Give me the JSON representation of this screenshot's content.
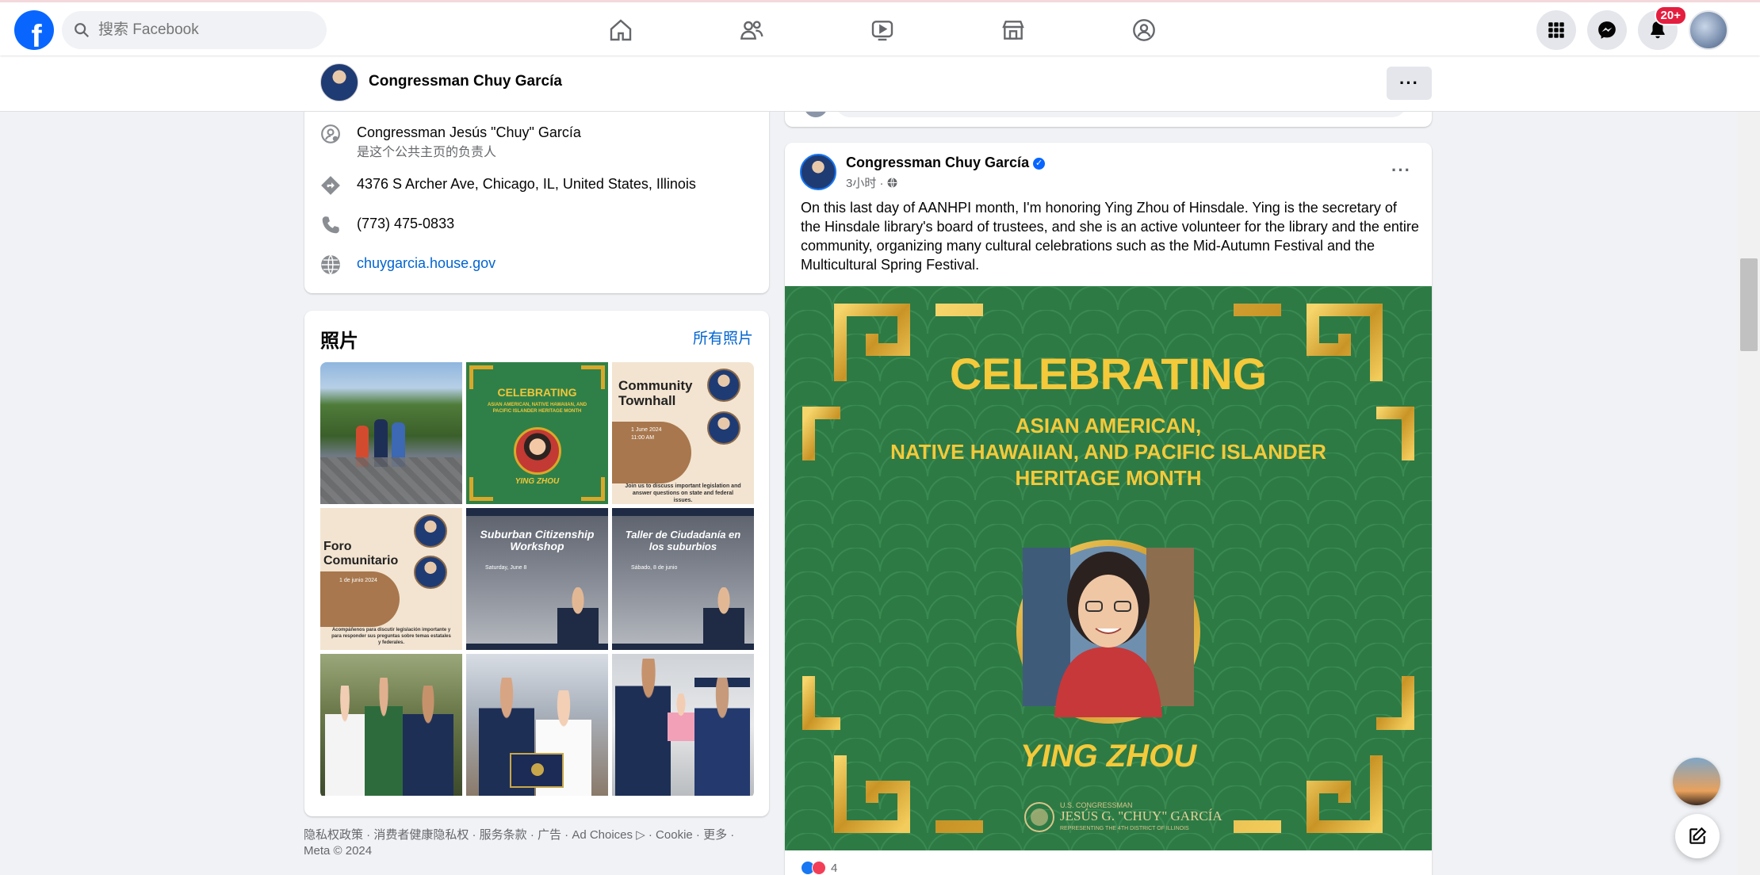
{
  "nav": {
    "logo": "f",
    "search_placeholder": "搜索 Facebook",
    "notifications_badge": "20+"
  },
  "page_header": {
    "name": "Congressman Chuy García",
    "more": "···"
  },
  "intro": {
    "owner_name": "Congressman Jesús \"Chuy\" García",
    "owner_role": "是这个公共主页的负责人",
    "address": "4376 S Archer Ave, Chicago, IL, United States, Illinois",
    "phone": "(773) 475-0833",
    "website": "chuygarcia.house.gov"
  },
  "photos": {
    "title": "照片",
    "see_all": "所有照片",
    "tiles": {
      "t2_title": "CELEBRATING",
      "t2_sub": "ASIAN AMERICAN, NATIVE HAWAIIAN, AND PACIFIC ISLANDER HERITAGE MONTH",
      "t2_name": "YING ZHOU",
      "t3_title": "Community Townhall",
      "t3_date": "1 June 2024",
      "t3_time": "11:00 AM",
      "t3_body": "Join us to discuss important legislation and answer questions on state and federal issues.",
      "t4_title": "Foro Comunitario",
      "t4_date": "1 de junio 2024",
      "t4_body": "Acompáñenos para discutir legislación importante y para responder sus preguntas sobre temas estatales y federales.",
      "t5_title": "Suburban Citizenship Workshop",
      "t5_date": "Saturday, June 8",
      "t6_title": "Taller de Ciudadanía en los suburbios",
      "t6_date": "Sábado, 8 de junio"
    }
  },
  "footer": {
    "line1": "隐私权政策 · 消费者健康隐私权 · 服务条款 · 广告 · Ad Choices ▷ · Cookie · 更多 ·",
    "line2": "Meta © 2024"
  },
  "post": {
    "author": "Congressman Chuy García",
    "time": "3小时 ·",
    "body": "On this last day of AANHPI month, I'm honoring Ying Zhou of Hinsdale. Ying is the secretary of the Hinsdale library's board of trustees, and she is an active volunteer for the library and the entire community, organizing many cultural celebrations such as the Mid-Autumn Festival and the Multicultural Spring Festival.",
    "image_title": "CELEBRATING",
    "image_line1": "ASIAN AMERICAN,",
    "image_line2": "NATIVE HAWAIIAN, AND PACIFIC ISLANDER",
    "image_line3": "HERITAGE MONTH",
    "image_name": "YING ZHOU",
    "image_seal_top": "U.S. CONGRESSMAN",
    "image_seal_name": "JESÚS G. \"CHUY\" GARCÍA",
    "image_seal_sub": "REPRESENTING THE 4TH DISTRICT OF ILLINOIS",
    "reaction_count": "4"
  },
  "colors": {
    "brand": "#0866ff",
    "link": "#0064d1",
    "badge": "#e41e3f",
    "post_green": "#2d7a45",
    "gold": "#d9a82a"
  }
}
